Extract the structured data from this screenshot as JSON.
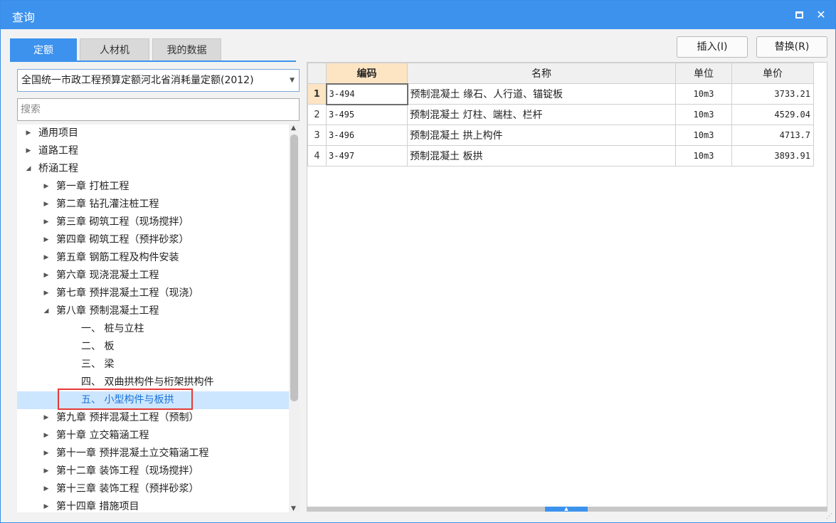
{
  "window": {
    "title": "查询",
    "maximize_icon": "maximize-icon",
    "close_glyph": "✕"
  },
  "tabs": [
    "定额",
    "人材机",
    "我的数据"
  ],
  "actions": {
    "insert_label": "插入(I)",
    "replace_label": "替换(R)"
  },
  "quota_select": {
    "value": "全国统一市政工程预算定额河北省消耗量定额(2012)"
  },
  "search": {
    "placeholder": "搜索"
  },
  "tree": [
    {
      "label": "通用项目",
      "level": 0,
      "state": "collapsed"
    },
    {
      "label": "道路工程",
      "level": 0,
      "state": "collapsed"
    },
    {
      "label": "桥涵工程",
      "level": 0,
      "state": "expanded"
    },
    {
      "label": "第一章 打桩工程",
      "level": 1,
      "state": "collapsed"
    },
    {
      "label": "第二章 钻孔灌注桩工程",
      "level": 1,
      "state": "collapsed"
    },
    {
      "label": "第三章 砌筑工程（现场搅拌）",
      "level": 1,
      "state": "collapsed"
    },
    {
      "label": "第四章 砌筑工程（预拌砂浆）",
      "level": 1,
      "state": "collapsed"
    },
    {
      "label": "第五章 钢筋工程及构件安装",
      "level": 1,
      "state": "collapsed"
    },
    {
      "label": "第六章 现浇混凝土工程",
      "level": 1,
      "state": "collapsed"
    },
    {
      "label": "第七章 预拌混凝土工程（现浇）",
      "level": 1,
      "state": "collapsed"
    },
    {
      "label": "第八章 预制混凝土工程",
      "level": 1,
      "state": "expanded"
    },
    {
      "label": "一、 桩与立柱",
      "level": 2,
      "state": "leaf"
    },
    {
      "label": "二、 板",
      "level": 2,
      "state": "leaf"
    },
    {
      "label": "三、 梁",
      "level": 2,
      "state": "leaf"
    },
    {
      "label": "四、 双曲拱构件与桁架拱构件",
      "level": 2,
      "state": "leaf"
    },
    {
      "label": "五、 小型构件与板拱",
      "level": 2,
      "state": "leaf",
      "selected": true
    },
    {
      "label": "第九章 预拌混凝土工程（预制）",
      "level": 1,
      "state": "collapsed"
    },
    {
      "label": "第十章 立交箱涵工程",
      "level": 1,
      "state": "collapsed"
    },
    {
      "label": "第十一章 预拌混凝土立交箱涵工程",
      "level": 1,
      "state": "collapsed"
    },
    {
      "label": "第十二章 装饰工程（现场搅拌）",
      "level": 1,
      "state": "collapsed"
    },
    {
      "label": "第十三章 装饰工程（预拌砂浆）",
      "level": 1,
      "state": "collapsed"
    },
    {
      "label": "第十四章 措施项目",
      "level": 1,
      "state": "collapsed"
    }
  ],
  "grid": {
    "columns": [
      "编码",
      "名称",
      "单位",
      "单价"
    ],
    "rows": [
      {
        "num": "1",
        "code": "3-494",
        "name": "预制混凝土 缘石、人行道、锚锭板",
        "unit": "10m3",
        "price": "3733.21"
      },
      {
        "num": "2",
        "code": "3-495",
        "name": "预制混凝土 灯柱、端柱、栏杆",
        "unit": "10m3",
        "price": "4529.04"
      },
      {
        "num": "3",
        "code": "3-496",
        "name": "预制混凝土 拱上构件",
        "unit": "10m3",
        "price": "4713.7"
      },
      {
        "num": "4",
        "code": "3-497",
        "name": "预制混凝土 板拱",
        "unit": "10m3",
        "price": "3893.91"
      }
    ]
  },
  "colors": {
    "accent": "#3c92ed",
    "selected_row": "#cde6ff",
    "current_header": "#fde5c4",
    "highlight_border": "#e53935"
  }
}
